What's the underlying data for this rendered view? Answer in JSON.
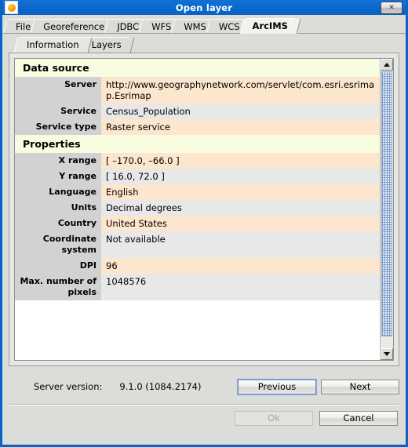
{
  "window": {
    "title": "Open layer",
    "icon": "app-icon",
    "close_label": "✕"
  },
  "outer_tabs": [
    {
      "label": "File",
      "selected": false
    },
    {
      "label": "Georeference",
      "selected": false
    },
    {
      "label": "JDBC",
      "selected": false
    },
    {
      "label": "WFS",
      "selected": false
    },
    {
      "label": "WMS",
      "selected": false
    },
    {
      "label": "WCS",
      "selected": false
    },
    {
      "label": "ArcIMS",
      "selected": true
    }
  ],
  "inner_tabs": [
    {
      "label": "Information",
      "selected": true
    },
    {
      "label": "Layers",
      "selected": false
    }
  ],
  "sections": [
    {
      "heading": "Data source",
      "rows": [
        {
          "label": "Server",
          "value": "http://www.geographynetwork.com/servlet/com.esri.esrimap.Esrimap"
        },
        {
          "label": "Service",
          "value": "Census_Population"
        },
        {
          "label": "Service type",
          "value": "Raster service"
        }
      ]
    },
    {
      "heading": "Properties",
      "rows": [
        {
          "label": "X range",
          "value": "[ –170.0, –66.0 ]"
        },
        {
          "label": "Y range",
          "value": "[ 16.0, 72.0 ]"
        },
        {
          "label": "Language",
          "value": "English"
        },
        {
          "label": "Units",
          "value": "Decimal degrees"
        },
        {
          "label": "Country",
          "value": "United States"
        },
        {
          "label": "Coordinate system",
          "value": "Not available"
        },
        {
          "label": "DPI",
          "value": "96"
        },
        {
          "label": "Max. number of pixels",
          "value": "1048576"
        }
      ]
    }
  ],
  "scrollbar": {
    "up_arrow": "scroll-up-arrow",
    "down_arrow": "scroll-down-arrow"
  },
  "footer": {
    "server_version_label": "Server version:",
    "server_version_value": "9.1.0 (1084.2174)",
    "previous_label": "Previous",
    "next_label": "Next",
    "ok_label": "Ok",
    "cancel_label": "Cancel"
  },
  "colors": {
    "titlebar": "#0a68cc",
    "section_header": "#f8fce0",
    "row_odd": "#fce6ce",
    "row_even": "#e8e8e8",
    "label_col": "#d2d2d2",
    "dialog_bg": "#dcdcd8"
  }
}
